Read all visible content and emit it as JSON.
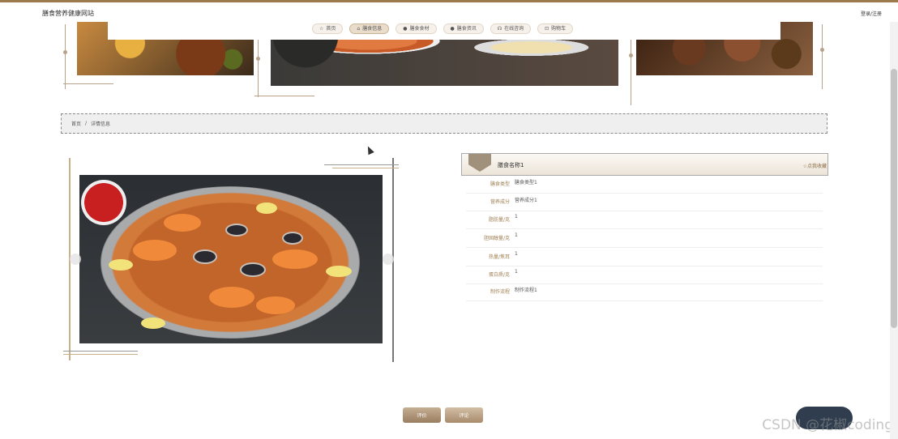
{
  "header": {
    "site_title": "膳食营养健康网站",
    "login_link": "登录/注册"
  },
  "nav": {
    "items": [
      {
        "label": "首页",
        "icon": "home-icon",
        "glyph": "☆",
        "active": false
      },
      {
        "label": "膳食信息",
        "icon": "info-icon",
        "glyph": "⌂",
        "active": true
      },
      {
        "label": "膳食食材",
        "icon": "ingredient-icon",
        "glyph": "●",
        "active": false
      },
      {
        "label": "膳食资讯",
        "icon": "news-icon",
        "glyph": "●",
        "active": false
      },
      {
        "label": "在线咨询",
        "icon": "chat-icon",
        "glyph": "☊",
        "active": false
      },
      {
        "label": "购物车",
        "icon": "cart-icon",
        "glyph": "⊡",
        "active": false
      }
    ]
  },
  "breadcrumb": {
    "home": "首页",
    "separator": "/",
    "current": "详情信息"
  },
  "detail": {
    "name": "膳食名称1",
    "favorite": "☆点我收藏",
    "rows": [
      {
        "label": "膳食类型",
        "value": "膳食类型1"
      },
      {
        "label": "营养成分",
        "value": "营养成分1"
      },
      {
        "label": "脂肪量/克",
        "value": "1"
      },
      {
        "label": "胆固醇量/克",
        "value": "1"
      },
      {
        "label": "热量/焦耳",
        "value": "1"
      },
      {
        "label": "蛋白质/克",
        "value": "1"
      },
      {
        "label": "制作流程",
        "value": "制作流程1"
      }
    ]
  },
  "buttons": {
    "review": "评价",
    "comment": "评论"
  },
  "watermark": "CSDN @花椒coding",
  "colors": {
    "accent": "#9c7a4e",
    "label": "#a08055"
  }
}
